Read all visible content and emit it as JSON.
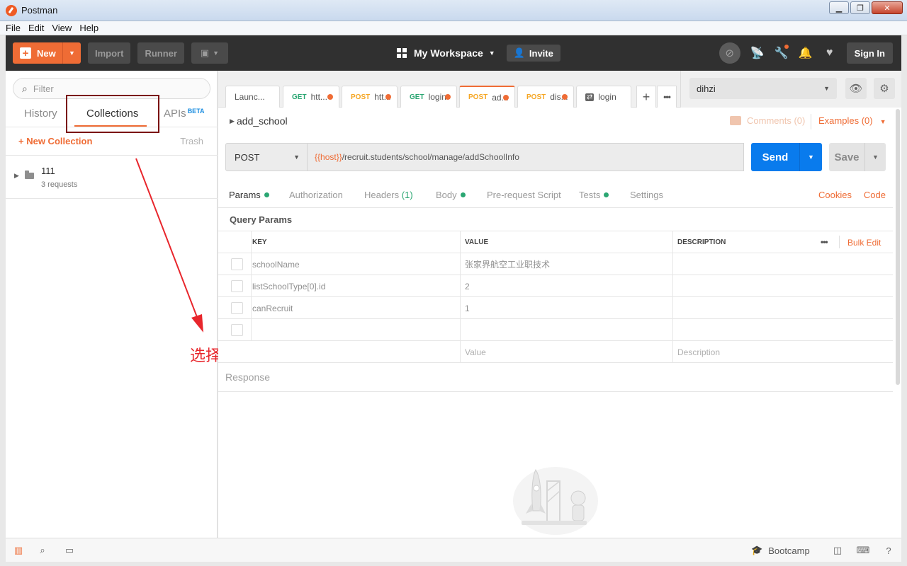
{
  "window": {
    "title": "Postman",
    "controls": [
      "minimize",
      "maximize",
      "close"
    ]
  },
  "menu": [
    "File",
    "Edit",
    "View",
    "Help"
  ],
  "toolbar": {
    "new_label": "New",
    "import_label": "Import",
    "runner_label": "Runner",
    "workspace_label": "My Workspace",
    "invite_label": "Invite",
    "signin_label": "Sign In",
    "accent": "#ef6c35"
  },
  "sidebar": {
    "filter_placeholder": "Filter",
    "tabs": {
      "history": "History",
      "collections": "Collections",
      "apis": "APIs",
      "beta": "BETA"
    },
    "new_collection_label": "New Collection",
    "trash_label": "Trash",
    "collections": [
      {
        "name": "111",
        "count": "3 requests"
      }
    ],
    "annotation": "选择这个新建项目",
    "annotation_color": "#e8262c"
  },
  "tabs": [
    {
      "method": "",
      "label": "Launc..."
    },
    {
      "method": "GET",
      "label": "htt..."
    },
    {
      "method": "POST",
      "label": "htt..."
    },
    {
      "method": "GET",
      "label": "login"
    },
    {
      "method": "POST",
      "label": "ad..."
    },
    {
      "method": "POST",
      "label": "dis..."
    },
    {
      "method": "",
      "label": "login"
    }
  ],
  "environment": {
    "selected": "dihzi"
  },
  "request": {
    "name": "add_school",
    "comments_label": "Comments (0)",
    "examples_label": "Examples (0)",
    "method": "POST",
    "url_var": "{{host}}",
    "url_path": "/recruit.students/school/manage/addSchoolInfo",
    "send_label": "Send",
    "save_label": "Save",
    "send_color": "#097bed"
  },
  "subtabs": {
    "params": "Params",
    "authorization": "Authorization",
    "headers": "Headers",
    "headers_count": "(1)",
    "body": "Body",
    "prerequest": "Pre-request Script",
    "tests": "Tests",
    "settings": "Settings",
    "cookies": "Cookies",
    "code": "Code"
  },
  "params": {
    "title": "Query Params",
    "headers": {
      "key": "KEY",
      "value": "VALUE",
      "description": "DESCRIPTION"
    },
    "bulk_edit": "Bulk Edit",
    "rows": [
      {
        "key": "schoolName",
        "value": "张家界航空工业职技术",
        "description": ""
      },
      {
        "key": "listSchoolType[0].id",
        "value": "2",
        "description": ""
      },
      {
        "key": "canRecruit",
        "value": "1",
        "description": ""
      },
      {
        "key": "",
        "value": "",
        "description": ""
      }
    ],
    "new_row": {
      "key": "",
      "value_placeholder": "Value",
      "description_placeholder": "Description"
    }
  },
  "response": {
    "label": "Response"
  },
  "statusbar": {
    "bootcamp_label": "Bootcamp"
  }
}
